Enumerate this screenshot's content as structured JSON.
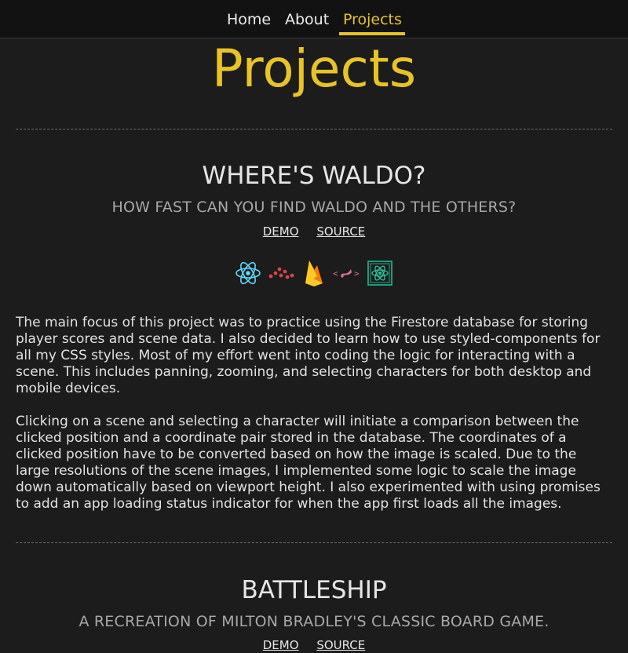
{
  "nav": {
    "items": [
      {
        "label": "Home"
      },
      {
        "label": "About"
      },
      {
        "label": "Projects"
      }
    ],
    "active": "Projects"
  },
  "page": {
    "title": "Projects"
  },
  "projects": [
    {
      "title": "WHERE'S WALDO?",
      "subtitle": "HOW FAST CAN YOU FIND WALDO AND THE OTHERS?",
      "demo_label": "DEMO",
      "source_label": "SOURCE",
      "tech_icons": [
        "react-icon",
        "rollup-icon",
        "firebase-icon",
        "styled-components-icon",
        "react-testing-library-icon"
      ],
      "paragraphs": [
        "The main focus of this project was to practice using the Firestore database for storing player scores and scene data. I also decided to learn how to use styled-components for all my CSS styles. Most of my effort went into coding the logic for interacting with a scene. This includes panning, zooming, and selecting characters for both desktop and mobile devices.",
        "Clicking on a scene and selecting a character will initiate a comparison between the clicked position and a coordinate pair stored in the database. The coordinates of a clicked position have to be converted based on how the image is scaled. Due to the large resolutions of the scene images, I implemented some logic to scale the image down automatically based on viewport height. I also experimented with using promises to add an app loading status indicator for when the app first loads all the images."
      ]
    },
    {
      "title": "BATTLESHIP",
      "subtitle": "A RECREATION OF MILTON BRADLEY'S CLASSIC BOARD GAME.",
      "demo_label": "DEMO",
      "source_label": "SOURCE"
    }
  ],
  "colors": {
    "accent": "#e8c327",
    "background": "#1c1c1c",
    "nav_background": "#121212"
  }
}
